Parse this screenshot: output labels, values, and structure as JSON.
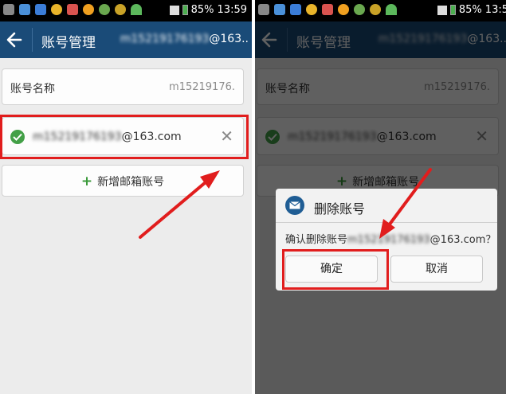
{
  "status_bar": {
    "battery": "85%",
    "time": "13:59",
    "time_clipped": "13:5"
  },
  "title_bar": {
    "title": "账号管理",
    "account_hidden": "m15219176193",
    "account_domain": "@163.."
  },
  "account_name_row": {
    "label": "账号名称",
    "value": "m15219176."
  },
  "account_row": {
    "email_hidden": "m15219176193",
    "email_domain": "@163.com"
  },
  "add_button": {
    "label": "新增邮箱账号"
  },
  "dialog": {
    "title": "删除账号",
    "message_prefix": "确认删除账号",
    "message_hidden": "m15219176193",
    "message_suffix": "@163.com？",
    "ok_label": "确定",
    "cancel_label": "取消"
  },
  "colors": {
    "title_bar": "#1a4b78",
    "highlight": "#e11d1d",
    "check": "#43a047",
    "plus": "#3a9a3a"
  }
}
